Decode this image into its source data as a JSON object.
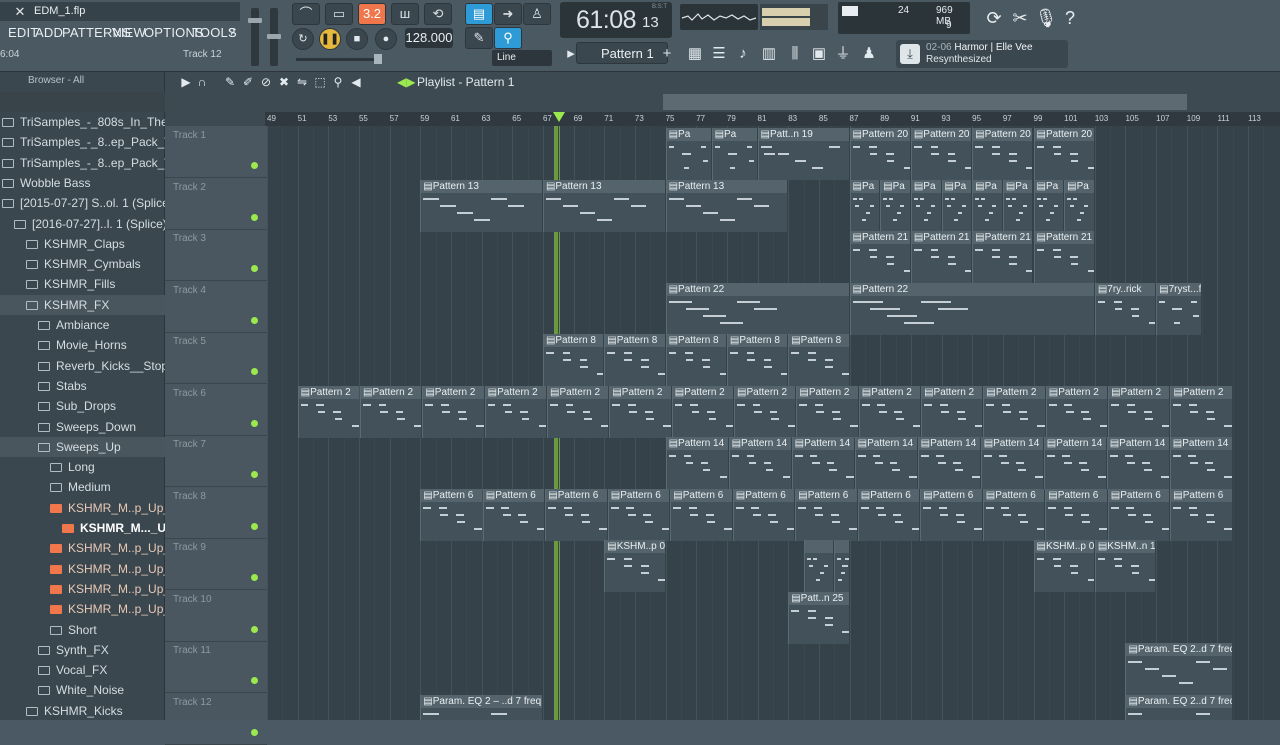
{
  "title": {
    "file": "EDM_1.flp"
  },
  "menu": [
    "EDIT",
    "ADD",
    "PATTERNS",
    "VIEW",
    "OPTIONS",
    "TOOLS",
    "?"
  ],
  "hint": {
    "time": "6:04",
    "track": "Track 12"
  },
  "transport": {
    "bpm": "128.000",
    "time": "61:08",
    "ticks": "13",
    "bst": "B:S:T",
    "snap": "3.2"
  },
  "cpu": {
    "polyphony": "24",
    "memory": "969 MB",
    "cpu": "9"
  },
  "pattern": {
    "selected": "Pattern 1",
    "mode": "Line"
  },
  "hintpanel": {
    "id": "02-06",
    "name": "Harmor | Elle Vee",
    "status": "Resynthesized"
  },
  "browser": {
    "header": "Browser - All",
    "items": [
      {
        "label": "TriSamples_-_808s_In_The_Box",
        "depth": 0
      },
      {
        "label": "TriSamples_-_8..ep_Pack_Vol_1",
        "depth": 0
      },
      {
        "label": "TriSamples_-_8..ep_Pack_Vol_2",
        "depth": 0
      },
      {
        "label": "Wobble Bass",
        "depth": 0
      },
      {
        "label": "[2015-07-27] S..ol. 1 (Splice)",
        "depth": 0
      },
      {
        "label": "[2016-07-27]..l. 1 (Splice)",
        "depth": 1
      },
      {
        "label": "KSHMR_Claps",
        "depth": 2
      },
      {
        "label": "KSHMR_Cymbals",
        "depth": 2
      },
      {
        "label": "KSHMR_Fills",
        "depth": 2
      },
      {
        "label": "KSHMR_FX",
        "depth": 2
      },
      {
        "label": "Ambiance",
        "depth": 3
      },
      {
        "label": "Movie_Horns",
        "depth": 3
      },
      {
        "label": "Reverb_Kicks__Stops",
        "depth": 3
      },
      {
        "label": "Stabs",
        "depth": 3
      },
      {
        "label": "Sub_Drops",
        "depth": 3
      },
      {
        "label": "Sweeps_Down",
        "depth": 3
      },
      {
        "label": "Sweeps_Up",
        "depth": 3
      },
      {
        "label": "Long",
        "depth": 4
      },
      {
        "label": "Medium",
        "depth": 4
      },
      {
        "label": "KSHMR_M..p_Up_01",
        "depth": 4,
        "file": true
      },
      {
        "label": "KSHMR_M..._Up_02",
        "depth": 5,
        "file": true,
        "selected": true
      },
      {
        "label": "KSHMR_M..p_Up_03",
        "depth": 4,
        "file": true
      },
      {
        "label": "KSHMR_M..p_Up_04",
        "depth": 4,
        "file": true
      },
      {
        "label": "KSHMR_M..p_Up_05",
        "depth": 4,
        "file": true
      },
      {
        "label": "KSHMR_M..p_Up_06",
        "depth": 4,
        "file": true
      },
      {
        "label": "Short",
        "depth": 4
      },
      {
        "label": "Synth_FX",
        "depth": 3
      },
      {
        "label": "Vocal_FX",
        "depth": 3
      },
      {
        "label": "White_Noise",
        "depth": 3
      },
      {
        "label": "KSHMR_Kicks",
        "depth": 2
      }
    ]
  },
  "playlist": {
    "title": "Playlist - Pattern 1",
    "ruler": [
      "49",
      "51",
      "53",
      "55",
      "57",
      "59",
      "61",
      "63",
      "65",
      "67",
      "69",
      "71",
      "73",
      "75",
      "77",
      "79",
      "81",
      "83",
      "85",
      "87",
      "89",
      "91",
      "93",
      "95",
      "97",
      "99",
      "101",
      "103",
      "105",
      "107",
      "109",
      "111",
      "113"
    ],
    "tracks": [
      "Track 1",
      "Track 2",
      "Track 3",
      "Track 4",
      "Track 5",
      "Track 6",
      "Track 7",
      "Track 8",
      "Track 9",
      "Track 10",
      "Track 11",
      "Track 12"
    ],
    "clips": [
      {
        "track": 0,
        "start": 75,
        "end": 87,
        "label": "Pa",
        "rep": 4
      },
      {
        "track": 0,
        "start": 81,
        "end": 87,
        "label": "Patt..n 19"
      },
      {
        "track": 0,
        "start": 87,
        "end": 103,
        "label": "Pattern 20",
        "rep": 4
      },
      {
        "track": 1,
        "start": 59,
        "end": 83,
        "label": "Pattern 13",
        "rep": 3
      },
      {
        "track": 1,
        "start": 87,
        "end": 103,
        "label": "Pa",
        "rep": 8
      },
      {
        "track": 2,
        "start": 87,
        "end": 103,
        "label": "Pattern 21",
        "rep": 4
      },
      {
        "track": 3,
        "start": 75,
        "end": 87,
        "label": "Pattern 22"
      },
      {
        "track": 3,
        "start": 87,
        "end": 103,
        "label": "Pattern 22"
      },
      {
        "track": 3,
        "start": 103,
        "end": 107,
        "label": "7ry..rick"
      },
      {
        "track": 3,
        "start": 107,
        "end": 110,
        "label": "7ryst...funny"
      },
      {
        "track": 4,
        "start": 67,
        "end": 87,
        "label": "Pattern 8",
        "rep": 5
      },
      {
        "track": 5,
        "start": 51,
        "end": 112,
        "label": "Pattern 2",
        "rep": 15
      },
      {
        "track": 6,
        "start": 75,
        "end": 112,
        "label": "Pattern 14",
        "rep": 9
      },
      {
        "track": 7,
        "start": 59,
        "end": 112,
        "label": "Pattern 6",
        "rep": 13
      },
      {
        "track": 8,
        "start": 71,
        "end": 75,
        "label": "KSHM..p 03"
      },
      {
        "track": 8,
        "start": 84,
        "end": 86,
        "label": ""
      },
      {
        "track": 8,
        "start": 86,
        "end": 87,
        "label": ""
      },
      {
        "track": 8,
        "start": 99,
        "end": 103,
        "label": "KSHM..p 03"
      },
      {
        "track": 8,
        "start": 103,
        "end": 107,
        "label": "KSHM..n 11"
      },
      {
        "track": 9,
        "start": 83,
        "end": 87,
        "label": "Patt..n 25"
      },
      {
        "track": 10,
        "start": 105,
        "end": 112,
        "label": "Param. EQ 2..d 7 freq #2"
      },
      {
        "track": 11,
        "start": 59,
        "end": 67,
        "label": "Param. EQ 2 – ..d 7 freq #3"
      },
      {
        "track": 11,
        "start": 105,
        "end": 112,
        "label": "Param. EQ 2..d 7 freq #4"
      }
    ]
  }
}
